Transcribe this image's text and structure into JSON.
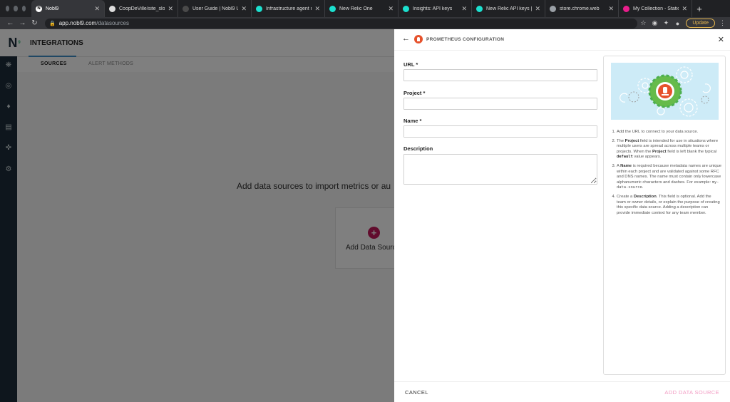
{
  "browser": {
    "tabs": [
      {
        "title": "Nobl9",
        "fav_color": "#ffffff",
        "fav_text": "N",
        "active": true
      },
      {
        "title": "CoopDeVille/site_slo",
        "fav_color": "#dddddd",
        "fav_text": "",
        "active": false
      },
      {
        "title": "User Guide | Nobl9 U",
        "fav_color": "#4a4a4a",
        "fav_text": "",
        "active": false
      },
      {
        "title": "Infrastructure agent n",
        "fav_color": "#1ce0cf",
        "fav_text": "",
        "active": false
      },
      {
        "title": "New Relic One",
        "fav_color": "#1ce0cf",
        "fav_text": "",
        "active": false
      },
      {
        "title": "Insights: API keys",
        "fav_color": "#1ce0cf",
        "fav_text": "",
        "active": false
      },
      {
        "title": "New Relic API keys | N",
        "fav_color": "#1ce0cf",
        "fav_text": "",
        "active": false
      },
      {
        "title": "store.chrome.web",
        "fav_color": "#9aa0a6",
        "fav_text": "",
        "active": false
      },
      {
        "title": "My Collection - Statio",
        "fav_color": "#e91e8c",
        "fav_text": "",
        "active": false
      }
    ],
    "new_tab": "+",
    "url_host": "app.nobl9.com",
    "url_path": "/datasources",
    "update_label": "Update"
  },
  "app": {
    "logo_text": "N",
    "header_title": "INTEGRATIONS",
    "subtabs": [
      "SOURCES",
      "ALERT METHODS"
    ],
    "empty_message": "Add data sources to import metrics or au",
    "add_card_label": "Add Data Sourc"
  },
  "panel": {
    "title": "PROMETHEUS CONFIGURATION",
    "fields": {
      "url_label": "URL *",
      "project_label": "Project *",
      "name_label": "Name *",
      "description_label": "Description",
      "url_value": "",
      "project_value": "",
      "name_value": "",
      "description_value": ""
    },
    "cancel_label": "CANCEL",
    "submit_label": "ADD DATA SOURCE"
  },
  "colors": {
    "accent_pink": "#c2185b",
    "submit_disabled": "#f29ac2",
    "prometheus_orange": "#e6522c",
    "sidenav": "#1c2d3a"
  }
}
